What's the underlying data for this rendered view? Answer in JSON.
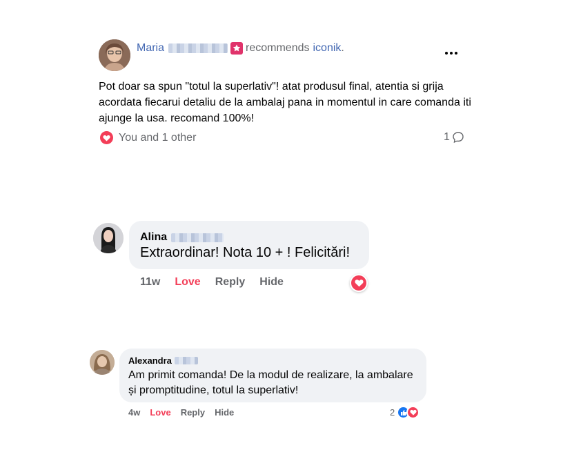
{
  "post": {
    "author": "Maria",
    "recommends_text": "recommends",
    "page_name": "iconik",
    "page_suffix": ".",
    "text": "Pot doar sa spun \"totul la superlativ\"! atat produsul final, atentia si grija acordata fiecarui detaliu de la ambalaj pana in momentul in care comanda iti ajunge la usa. recomand 100%!",
    "reactions_text": "You and 1 other",
    "comment_count": "1"
  },
  "comments": [
    {
      "name": "Alina",
      "text": "Extraordinar! Nota 10 + ! Felicitări!",
      "time": "11w",
      "love": "Love",
      "reply": "Reply",
      "hide": "Hide"
    },
    {
      "name": "Alexandra",
      "text": "Am primit comanda! De la modul de realizare, la ambalare și promptitudine, totul la superlativ!",
      "time": "4w",
      "love": "Love",
      "reply": "Reply",
      "hide": "Hide",
      "reaction_count": "2"
    }
  ],
  "colors": {
    "link_blue": "#4267B2",
    "love_red": "#f33e58",
    "like_blue": "#1877f2",
    "bubble_bg": "#f0f2f5",
    "muted_text": "#65676b"
  }
}
